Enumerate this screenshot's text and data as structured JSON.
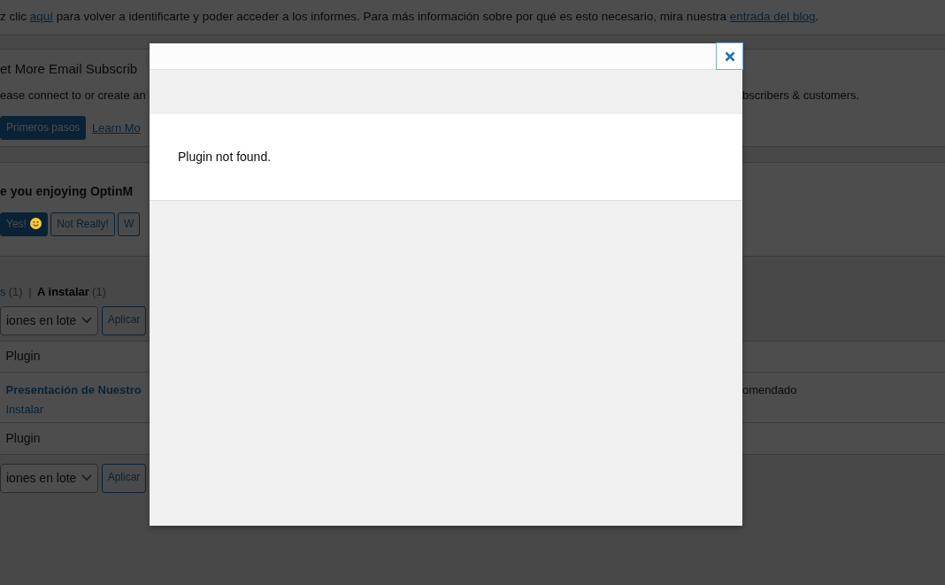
{
  "notice": [
    {
      "kind": "text",
      "text": "z clic "
    },
    {
      "kind": "link",
      "text": "aquí"
    },
    {
      "kind": "text",
      "text": " para volver a identificarte y poder acceder a los informes. Para más información sobre por qué es esto necesario, mira nuestra "
    },
    {
      "kind": "link",
      "text": "entrada del blog"
    },
    {
      "kind": "text",
      "text": "."
    }
  ],
  "email_card": {
    "title": "et More Email Subscrib",
    "description": "ease connect to or create an",
    "description_right": "bscribers & customers.",
    "primary_button": "Primeros pasos",
    "link": "Learn Mo"
  },
  "feedback_card": {
    "title": "e you enjoying OptinM",
    "buttons": [
      {
        "label": "Yes!",
        "primary": true,
        "kind": "smile"
      },
      {
        "label": "Not Really!",
        "primary": false,
        "kind": "plain"
      },
      {
        "label": "W",
        "primary": false,
        "kind": "plain"
      }
    ]
  },
  "filters": [
    {
      "label": "s",
      "count": "(1)",
      "selected": false
    },
    {
      "label": "A instalar",
      "count": "(1)",
      "selected": true
    }
  ],
  "filter_separator": "|",
  "bulk_actions_top": {
    "select": "iones en lote",
    "button": "Aplicar"
  },
  "table": {
    "header": "Plugin",
    "rows": [
      {
        "name": "Presentación de Nuestro",
        "action": "Instalar",
        "column_right": "omendado"
      }
    ],
    "footer": "Plugin"
  },
  "bulk_actions_bottom": {
    "select": "iones en lote",
    "button": "Aplicar"
  },
  "modal": {
    "message": "Plugin not found."
  }
}
